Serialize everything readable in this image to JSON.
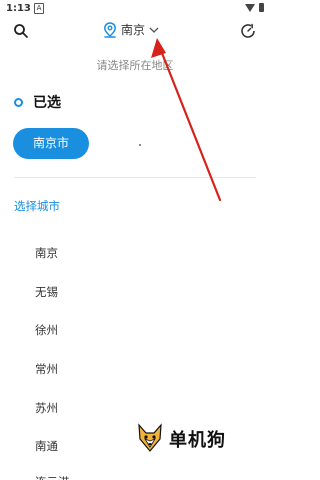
{
  "status_bar": {
    "time": "1:13",
    "notification_glyph": "A"
  },
  "header": {
    "city": "南京",
    "location_icon": "location-pin-icon",
    "dropdown_icon": "chevron-down-icon"
  },
  "hint": "请选择所在地区",
  "selected": {
    "title": "已选",
    "city": "南京市"
  },
  "section": {
    "label": "选择城市"
  },
  "cities": [
    "南京",
    "无锡",
    "徐州",
    "常州",
    "苏州",
    "南通",
    "连云港"
  ],
  "watermark": {
    "text": "单机狗"
  },
  "colors": {
    "accent": "#1a8fe0",
    "annotation_arrow": "#d6221b"
  }
}
